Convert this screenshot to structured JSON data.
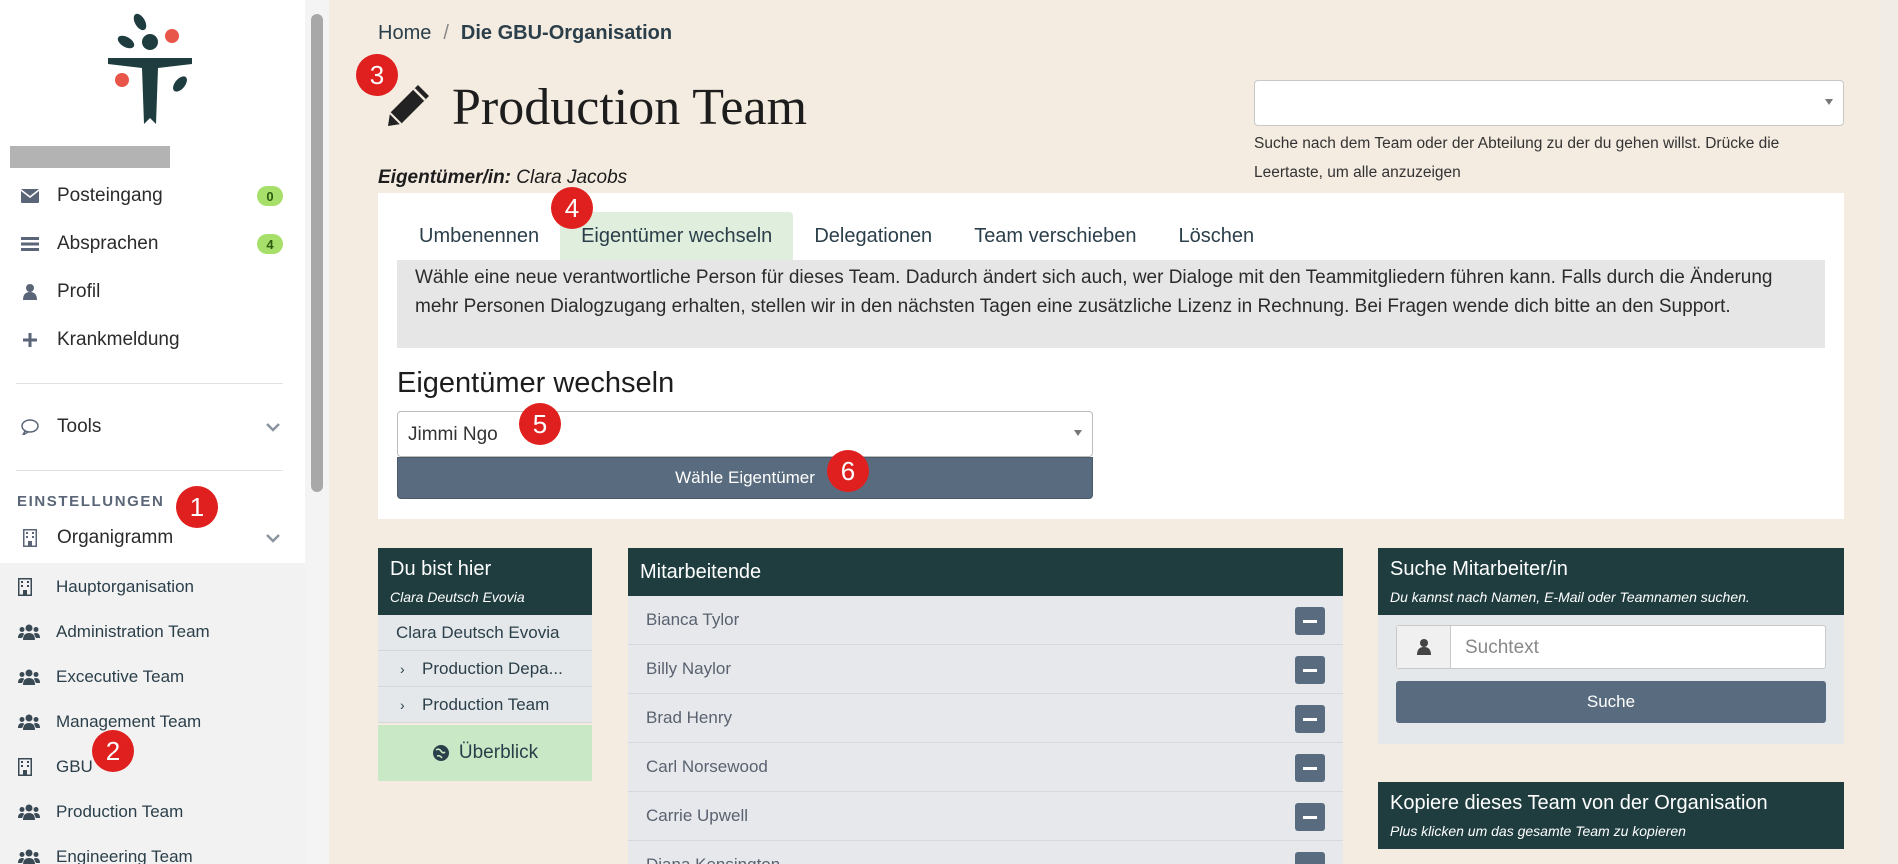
{
  "sidebar": {
    "inbox": {
      "label": "Posteingang",
      "badge": "0"
    },
    "agreements": {
      "label": "Absprachen",
      "badge": "4"
    },
    "profile": {
      "label": "Profil"
    },
    "sick": {
      "label": "Krankmeldung"
    },
    "tools": {
      "label": "Tools"
    },
    "settings_title": "EINSTELLUNGEN",
    "org": {
      "label": "Organigramm"
    },
    "sub_items": [
      {
        "label": "Hauptorganisation",
        "icon": "building-icon"
      },
      {
        "label": "Administration Team",
        "icon": "users-icon"
      },
      {
        "label": "Excecutive Team",
        "icon": "users-icon"
      },
      {
        "label": "Management Team",
        "icon": "users-icon"
      },
      {
        "label": "GBU",
        "icon": "building-icon"
      },
      {
        "label": "Production Team",
        "icon": "users-icon"
      },
      {
        "label": "Engineering Team",
        "icon": "users-icon"
      }
    ]
  },
  "markers": [
    "1",
    "2",
    "3",
    "4",
    "5",
    "6"
  ],
  "breadcrumb": {
    "home": "Home",
    "sep": "/",
    "current": "Die GBU-Organisation"
  },
  "header": {
    "title": "Production Team",
    "owner_label": "Eigentümer/in:",
    "owner_name": "Clara Jacobs",
    "team_search_help": "Suche nach dem Team oder der Abteilung zu der du gehen willst. Drücke die Leertaste, um alle anzuzeigen"
  },
  "tabs": [
    "Umbenennen",
    "Eigentümer wechseln",
    "Delegationen",
    "Team verschieben",
    "Löschen"
  ],
  "active_tab": 1,
  "owner_change": {
    "info": "Wähle eine neue verantwortliche Person für dieses Team. Dadurch ändert sich auch, wer Dialoge mit den Teammitgliedern führen kann. Falls durch die Änderung mehr Personen Dialogzugang erhalten, stellen wir in den nächsten Tagen eine zusätzliche Lizenz in Rechnung. Bei Fragen wende dich bitte an den Support.",
    "title": "Eigentümer wechseln",
    "selected": "Jimmi Ngo",
    "button": "Wähle Eigentümer"
  },
  "here": {
    "title": "Du bist hier",
    "subtitle": "Clara Deutsch Evovia",
    "rows": [
      "Clara Deutsch Evovia",
      "Production Depa...",
      "Production Team"
    ],
    "overview": "Überblick"
  },
  "members": {
    "title": "Mitarbeitende",
    "list": [
      "Bianca Tylor",
      "Billy Naylor",
      "Brad Henry",
      "Carl Norsewood",
      "Carrie Upwell",
      "Diana Kensington"
    ]
  },
  "search": {
    "title": "Suche Mitarbeiter/in",
    "subtitle": "Du kannst nach Namen, E-Mail oder Teamnamen suchen.",
    "placeholder": "Suchtext",
    "button": "Suche"
  },
  "copy": {
    "title": "Kopiere dieses Team von der Organisation",
    "subtitle": "Plus klicken um das gesamte Team zu kopieren"
  }
}
